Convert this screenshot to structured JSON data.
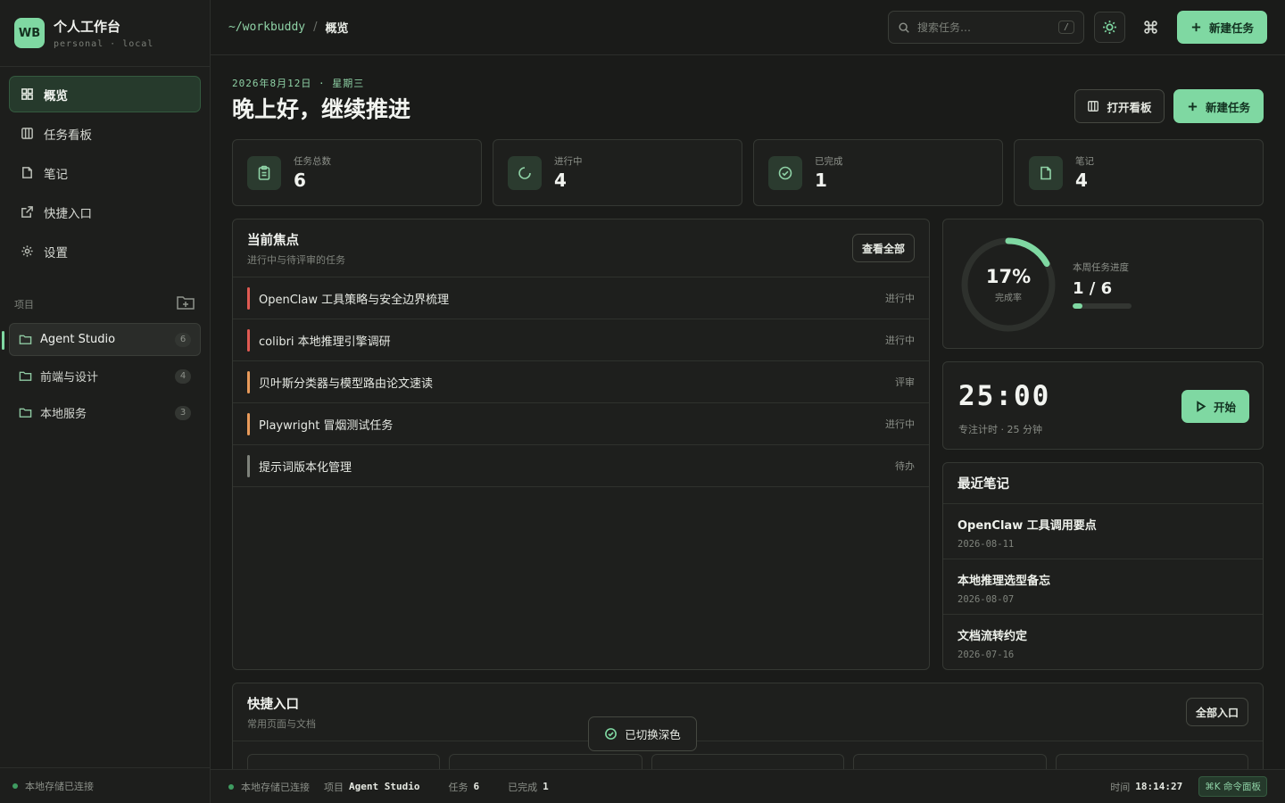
{
  "brand": {
    "logo": "WB",
    "title": "个人工作台",
    "subtitle": "personal · local"
  },
  "nav": [
    {
      "label": "概览",
      "icon": "grid-icon",
      "active": true
    },
    {
      "label": "任务看板",
      "icon": "columns-icon"
    },
    {
      "label": "笔记",
      "icon": "file-icon"
    },
    {
      "label": "快捷入口",
      "icon": "external-link-icon"
    },
    {
      "label": "设置",
      "icon": "gear-icon"
    }
  ],
  "projects": {
    "label": "项目",
    "items": [
      {
        "name": "Agent Studio",
        "count": "6",
        "active": true
      },
      {
        "name": "前端与设计",
        "count": "4"
      },
      {
        "name": "本地服务",
        "count": "3"
      }
    ]
  },
  "sidebar_footer": "本地存储已连接",
  "topbar": {
    "path": "~/workbuddy",
    "separator": "/",
    "current": "概览",
    "search_placeholder": "搜索任务…",
    "search_key": "/",
    "new_task": "新建任务"
  },
  "header": {
    "date": "2026年8月12日 · 星期三",
    "greeting": "晚上好，继续推进",
    "open_board": "打开看板",
    "new_task": "新建任务"
  },
  "stats": [
    {
      "label": "任务总数",
      "value": "6",
      "icon": "clipboard-icon"
    },
    {
      "label": "进行中",
      "value": "4",
      "icon": "loading-icon"
    },
    {
      "label": "已完成",
      "value": "1",
      "icon": "check-circle-icon"
    },
    {
      "label": "笔记",
      "value": "4",
      "icon": "note-icon"
    }
  ],
  "focus": {
    "title": "当前焦点",
    "subtitle": "进行中与待评审的任务",
    "view_all": "查看全部",
    "tasks": [
      {
        "title": "OpenClaw 工具策略与安全边界梳理",
        "status": "进行中",
        "color": "#e05a52"
      },
      {
        "title": "colibri 本地推理引擎调研",
        "status": "进行中",
        "color": "#e05a52"
      },
      {
        "title": "贝叶斯分类器与模型路由论文速读",
        "status": "评审",
        "color": "#e89a5a"
      },
      {
        "title": "Playwright 冒烟测试任务",
        "status": "进行中",
        "color": "#e89a5a"
      },
      {
        "title": "提示词版本化管理",
        "status": "待办",
        "color": "#7e827b"
      }
    ]
  },
  "progress": {
    "percent_label": "17%",
    "ring_caption": "完成率",
    "label": "本周任务进度",
    "fraction": "1 / 6",
    "value": 0.17
  },
  "timer": {
    "time": "25:00",
    "caption": "专注计时 · 25 分钟",
    "start": "开始"
  },
  "notes": {
    "title": "最近笔记",
    "items": [
      {
        "title": "OpenClaw 工具调用要点",
        "date": "2026-08-11"
      },
      {
        "title": "本地推理选型备忘",
        "date": "2026-08-07"
      },
      {
        "title": "文档流转约定",
        "date": "2026-07-16"
      }
    ]
  },
  "quick": {
    "title": "快捷入口",
    "subtitle": "常用页面与文档",
    "all": "全部入口"
  },
  "toast": "已切换深色",
  "statusbar": {
    "storage": "本地存储已连接",
    "project_label": "项目",
    "project_value": "Agent Studio",
    "tasks_label": "任务",
    "tasks_value": "6",
    "done_label": "已完成",
    "done_value": "1",
    "time_label": "时间",
    "time_value": "18:14:27",
    "command": "⌘K 命令面板"
  },
  "colors": {
    "accent": "#7fd8a2",
    "background": "#1a1b19",
    "panel": "#1e1f1d"
  }
}
